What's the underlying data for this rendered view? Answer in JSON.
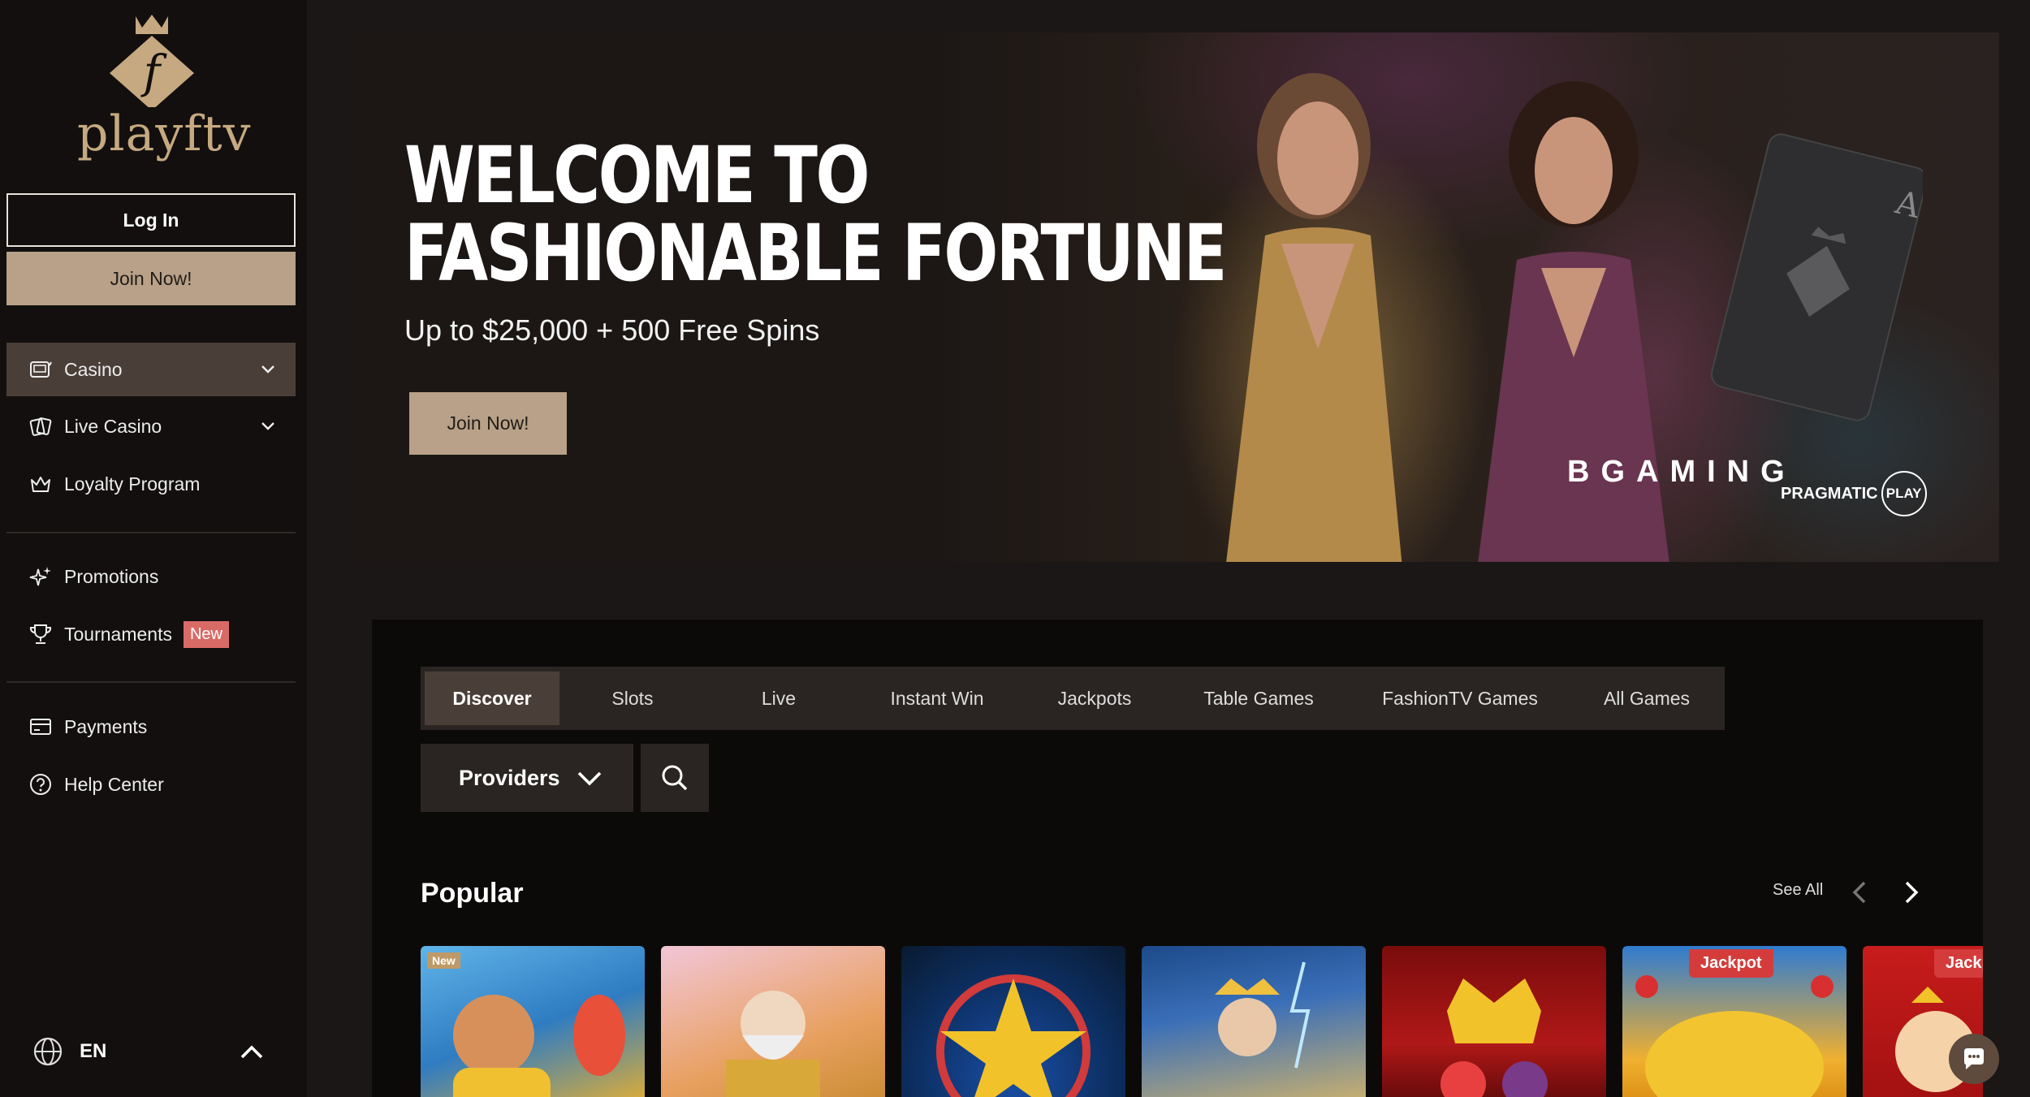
{
  "brand": {
    "name": "playftv",
    "logo_letter": "f"
  },
  "sidebar": {
    "login_label": "Log In",
    "join_label": "Join Now!",
    "items": [
      {
        "label": "Casino",
        "icon": "slot-machine-icon",
        "expandable": true,
        "active": true
      },
      {
        "label": "Live Casino",
        "icon": "cards-icon",
        "expandable": true,
        "active": false
      },
      {
        "label": "Loyalty Program",
        "icon": "crown-icon",
        "expandable": false,
        "active": false
      },
      {
        "label": "Promotions",
        "icon": "sparkles-icon",
        "expandable": false,
        "active": false
      },
      {
        "label": "Tournaments",
        "icon": "trophy-icon",
        "expandable": false,
        "active": false,
        "badge": "New"
      },
      {
        "label": "Payments",
        "icon": "card-icon",
        "expandable": false,
        "active": false
      },
      {
        "label": "Help Center",
        "icon": "question-icon",
        "expandable": false,
        "active": false
      }
    ],
    "language": "EN"
  },
  "hero": {
    "title_line1": "WELCOME TO",
    "title_line2": "FASHIONABLE FORTUNE",
    "subtitle": "Up to $25,000 + 500 Free Spins",
    "cta_label": "Join Now!",
    "partner1": "BGAMING",
    "partner2": "PRAGMATIC",
    "partner2_suffix": "PLAY"
  },
  "games": {
    "tabs": [
      {
        "label": "Discover",
        "active": true
      },
      {
        "label": "Slots",
        "active": false
      },
      {
        "label": "Live",
        "active": false
      },
      {
        "label": "Instant Win",
        "active": false
      },
      {
        "label": "Jackpots",
        "active": false
      },
      {
        "label": "Table Games",
        "active": false
      },
      {
        "label": "FashionTV Games",
        "active": false
      },
      {
        "label": "All Games",
        "active": false
      }
    ],
    "providers_label": "Providers",
    "section_title": "Popular",
    "see_all_label": "See All",
    "tiles": [
      {
        "name": "fishing-game",
        "badge": "New"
      },
      {
        "name": "zeus-game"
      },
      {
        "name": "star-game"
      },
      {
        "name": "gates-game"
      },
      {
        "name": "crown-fruits-game"
      },
      {
        "name": "gold-jackpot-game",
        "jackpot": "Jackpot"
      },
      {
        "name": "pig-jackpot-game",
        "jackpot": "Jackpot"
      }
    ]
  },
  "colors": {
    "accent": "#b8a188",
    "sidebar_bg": "#120f0e",
    "page_bg": "#1a1716",
    "active_item": "#4a3f38",
    "badge": "#d96b67"
  }
}
